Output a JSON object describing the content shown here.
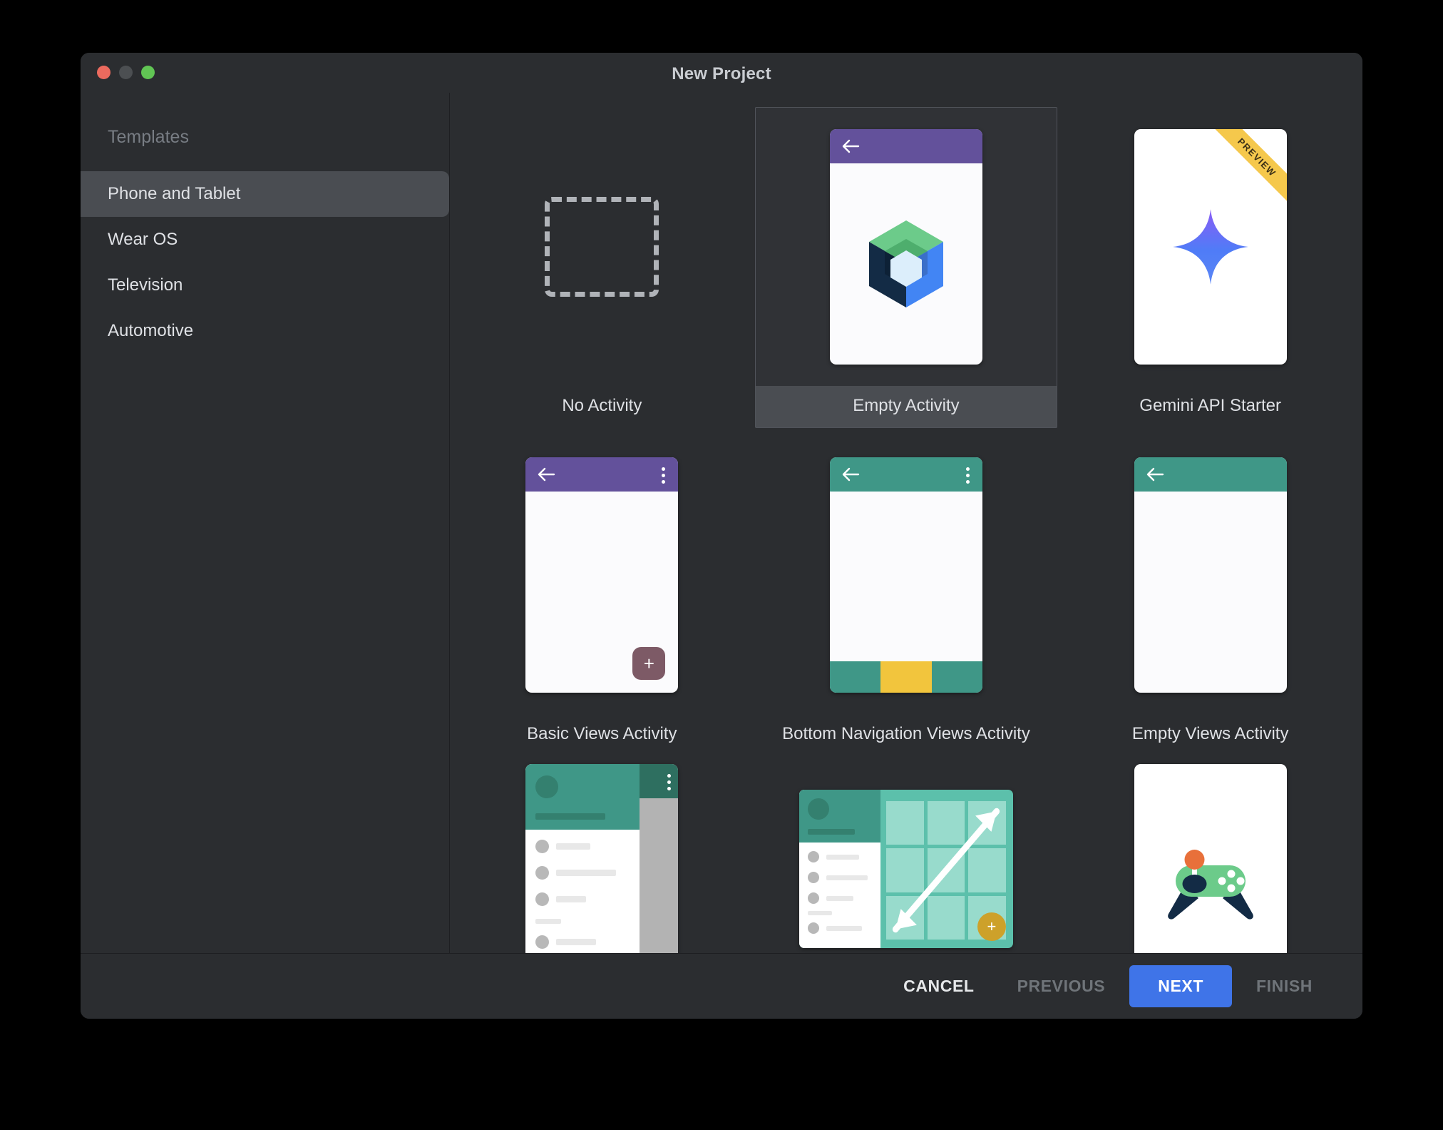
{
  "window": {
    "title": "New Project",
    "traffic_lights": [
      "close",
      "minimize",
      "maximize"
    ]
  },
  "sidebar": {
    "heading": "Templates",
    "items": [
      {
        "label": "Phone and Tablet",
        "selected": true
      },
      {
        "label": "Wear OS",
        "selected": false
      },
      {
        "label": "Television",
        "selected": false
      },
      {
        "label": "Automotive",
        "selected": false
      }
    ]
  },
  "templates": [
    {
      "label": "No Activity",
      "kind": "dashed",
      "selected": false
    },
    {
      "label": "Empty Activity",
      "kind": "compose",
      "selected": true,
      "appbar": "purple"
    },
    {
      "label": "Gemini API Starter",
      "kind": "gemini",
      "selected": false,
      "badge": "PREVIEW"
    },
    {
      "label": "Basic Views Activity",
      "kind": "phone-fab",
      "selected": false,
      "appbar": "purple"
    },
    {
      "label": "Bottom Navigation Views Activity",
      "kind": "phone-bnav",
      "selected": false,
      "appbar": "teal"
    },
    {
      "label": "Empty Views Activity",
      "kind": "phone-plain",
      "selected": false,
      "appbar": "teal"
    },
    {
      "label": "",
      "kind": "drawer",
      "selected": false
    },
    {
      "label": "",
      "kind": "responsive",
      "selected": false
    },
    {
      "label": "",
      "kind": "game",
      "selected": false
    }
  ],
  "footer": {
    "cancel": "CANCEL",
    "previous": "PREVIOUS",
    "next": "NEXT",
    "finish": "FINISH"
  },
  "colors": {
    "window_bg": "#2b2d30",
    "selection": "#4a4d52",
    "primary_button": "#3f74e8",
    "appbar_purple": "#63519b",
    "appbar_teal": "#3f9787",
    "fab_mauve": "#7d5a66",
    "fab_gold": "#cda12a",
    "bottom_nav_yellow": "#f2c53d",
    "ribbon_gold": "#f5c council"
  }
}
